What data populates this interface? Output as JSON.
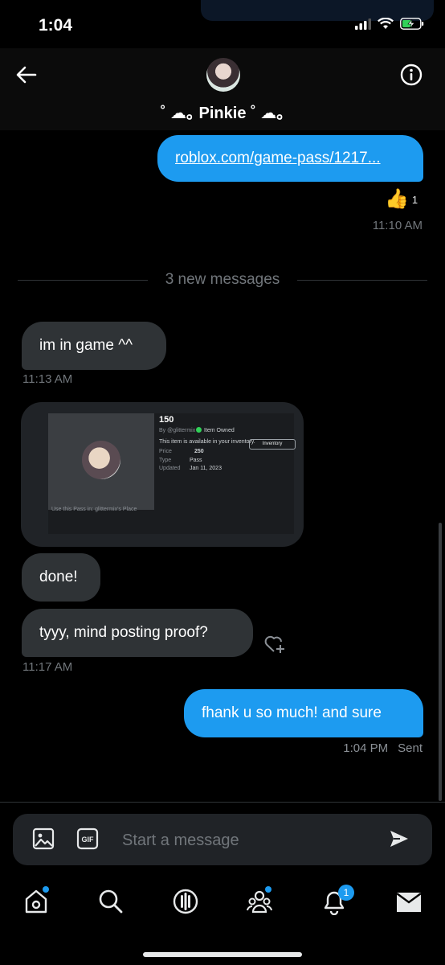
{
  "status_bar": {
    "time": "1:04"
  },
  "header": {
    "name": "˚ ☁︎｡ Pinkie ˚ ☁︎｡"
  },
  "messages": {
    "link": {
      "text": "roblox.com/game-pass/1217...",
      "reaction_emoji": "👍",
      "reaction_count": "1",
      "timestamp": "11:10 AM"
    },
    "divider": "3 new messages",
    "in1": {
      "text": "im in game ^^",
      "timestamp": "11:13 AM"
    },
    "media": {
      "title": "150",
      "by": "By @glittermix",
      "owned": "Item Owned",
      "available": "This item is available in your inventory.",
      "inventory_button": "Inventory",
      "price_label": "Price",
      "price_value": "250",
      "type_label": "Type",
      "type_value": "Pass",
      "updated_label": "Updated",
      "updated_value": "Jan 11, 2023",
      "place_text": "Use this Pass in: glittermix's Place"
    },
    "in2": {
      "text": "done!"
    },
    "in3": {
      "text": "tyyy, mind posting proof?",
      "timestamp": "11:17 AM"
    },
    "out": {
      "text": "fhank u so much! and sure",
      "timestamp": "1:04 PM",
      "status": "Sent"
    }
  },
  "composer": {
    "placeholder": "Start a message"
  },
  "nav": {
    "notifications_badge": "1"
  },
  "colors": {
    "accent": "#1d9bf0",
    "incoming_bubble": "#2f3336",
    "background": "#000000"
  }
}
